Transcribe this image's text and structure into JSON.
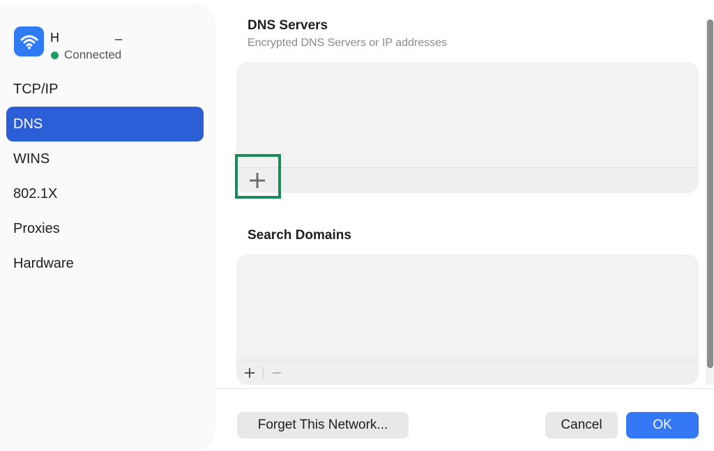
{
  "network": {
    "name": "H",
    "name_suffix": "_",
    "status": "Connected",
    "status_color": "#1f9d60",
    "icon": "wifi-icon"
  },
  "sidebar": {
    "items": [
      {
        "label": "TCP/IP",
        "active": false
      },
      {
        "label": "DNS",
        "active": true
      },
      {
        "label": "WINS",
        "active": false
      },
      {
        "label": "802.1X",
        "active": false
      },
      {
        "label": "Proxies",
        "active": false
      },
      {
        "label": "Hardware",
        "active": false
      }
    ]
  },
  "dns_servers": {
    "title": "DNS Servers",
    "subtitle": "Encrypted DNS Servers or IP addresses",
    "add_icon": "plus-icon"
  },
  "search_domains": {
    "title": "Search Domains",
    "add_icon": "plus-icon",
    "remove_icon": "minus-icon"
  },
  "footer": {
    "forget_label": "Forget This Network...",
    "cancel_label": "Cancel",
    "ok_label": "OK"
  },
  "colors": {
    "accent": "#3478f6",
    "selected_nav": "#2c5fd7",
    "highlight": "#1b8a5c"
  }
}
